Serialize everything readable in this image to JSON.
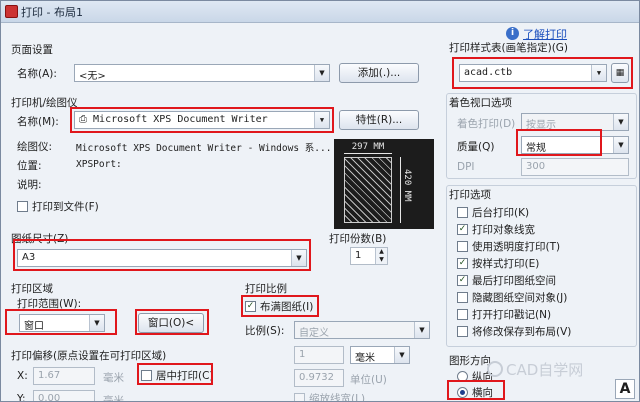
{
  "window": {
    "title": "打印 - 布局1",
    "help_link": "了解打印",
    "help_icon": "info-icon"
  },
  "page_setup": {
    "section": "页面设置",
    "name_label": "名称(A):",
    "name_value": "<无>",
    "add_button": "添加(.)..."
  },
  "printer": {
    "section": "打印机/绘图仪",
    "name_label": "名称(M):",
    "name_value": "Microsoft XPS Document Writer",
    "properties_button": "特性(R)...",
    "plotter_label": "绘图仪:",
    "plotter_value": "Microsoft XPS Document Writer - Windows 系...",
    "where_label": "位置:",
    "where_value": "XPSPort:",
    "desc_label": "说明:",
    "print_to_file": "打印到文件(F)",
    "preview_width": "297 MM",
    "preview_height": "420 MM"
  },
  "paper_size": {
    "section": "图纸尺寸(Z)",
    "value": "A3"
  },
  "copies": {
    "section": "打印份数(B)",
    "value": "1"
  },
  "plot_area": {
    "section": "打印区域",
    "range_label": "打印范围(W):",
    "range_value": "窗口",
    "window_button": "窗口(O)<"
  },
  "plot_scale": {
    "section": "打印比例",
    "fit_paper": "布满图纸(I)",
    "scale_label": "比例(S):",
    "scale_value": "自定义",
    "value1": "1",
    "unit": "毫米",
    "value2": "0.9732",
    "unit2": "单位(U)",
    "lineweights": "缩放线宽(L)"
  },
  "plot_offset": {
    "section": "打印偏移(原点设置在可打印区域)",
    "x_label": "X:",
    "x_value": "1.67",
    "x_unit": "毫米",
    "y_label": "Y:",
    "y_value": "0.00",
    "y_unit": "毫米",
    "center_plot": "居中打印(C)"
  },
  "style_table": {
    "section": "打印样式表(画笔指定)(G)",
    "value": "acad.ctb",
    "edit_icon": "edit-grid-icon"
  },
  "shaded_viewport": {
    "section": "着色视口选项",
    "shade_label": "着色打印(D)",
    "shade_value": "按显示",
    "quality_label": "质量(Q)",
    "quality_value": "常规",
    "dpi_label": "DPI",
    "dpi_value": "300"
  },
  "plot_options": {
    "section": "打印选项",
    "items": [
      {
        "label": "后台打印(K)",
        "checked": false
      },
      {
        "label": "打印对象线宽",
        "checked": true
      },
      {
        "label": "使用透明度打印(T)",
        "checked": false
      },
      {
        "label": "按样式打印(E)",
        "checked": true
      },
      {
        "label": "最后打印图纸空间",
        "checked": true
      },
      {
        "label": "隐藏图纸空间对象(J)",
        "checked": false
      },
      {
        "label": "打开打印戳记(N)",
        "checked": false
      },
      {
        "label": "将修改保存到布局(V)",
        "checked": false
      }
    ]
  },
  "orientation": {
    "section": "图形方向",
    "portrait": "纵向",
    "landscape": "横向"
  },
  "watermark": {
    "text": "CAD自学网"
  }
}
